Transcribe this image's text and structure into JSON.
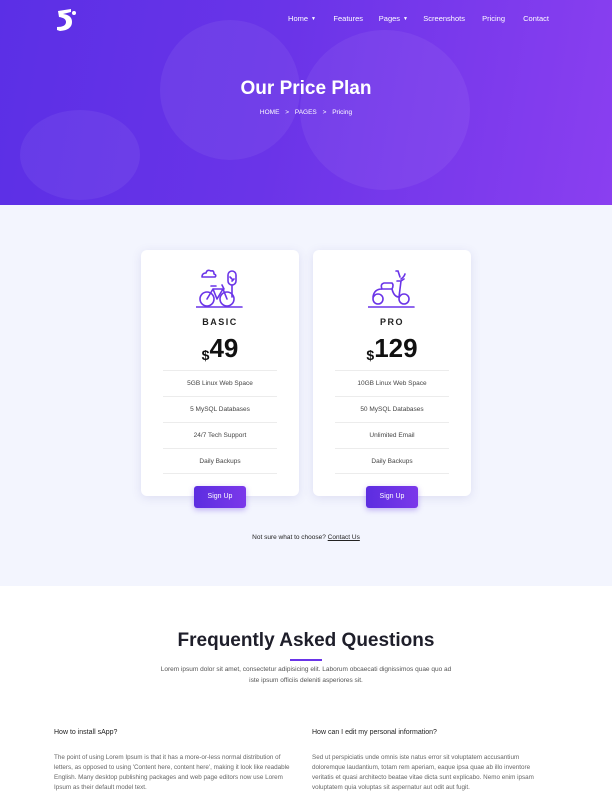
{
  "header": {
    "logo_icon": "s-logo-icon",
    "nav": [
      {
        "label": "Home",
        "dropdown": true
      },
      {
        "label": "Features",
        "dropdown": false
      },
      {
        "label": "Pages",
        "dropdown": true
      },
      {
        "label": "Screenshots",
        "dropdown": false
      },
      {
        "label": "Pricing",
        "dropdown": false
      },
      {
        "label": "Contact",
        "dropdown": false
      }
    ]
  },
  "hero": {
    "title": "Our Price Plan",
    "breadcrumb": [
      "HOME",
      ">",
      "PAGES",
      ">",
      "Pricing"
    ]
  },
  "plans": [
    {
      "icon": "bicycle-icon",
      "name": "BASIC",
      "currency": "$",
      "price": "49",
      "features": [
        "5GB Linux Web Space",
        "5 MySQL Databases",
        "24/7 Tech Support",
        "Daily Backups"
      ],
      "button": "Sign Up"
    },
    {
      "icon": "scooter-icon",
      "name": "PRO",
      "currency": "$",
      "price": "129",
      "features": [
        "10GB Linux Web Space",
        "50 MySQL Databases",
        "Unlimited Email",
        "Daily Backups"
      ],
      "button": "Sign Up"
    }
  ],
  "choose": {
    "text": "Not sure what to choose? ",
    "link": "Contact Us"
  },
  "faq": {
    "title": "Frequently Asked Questions",
    "subtitle": "Lorem ipsum dolor sit amet, consectetur adipisicing elit. Laborum obcaecati dignissimos quae quo ad iste ipsum officiis deleniti asperiores sit.",
    "items": [
      {
        "question": "How to install sApp?",
        "answer": "The point of using Lorem Ipsum is that it has a more-or-less normal distribution of letters, as opposed to using 'Content here, content here', making it look like readable English. Many desktop publishing packages and web page editors now use Lorem Ipsum as their default model text."
      },
      {
        "question": "How can I edit my personal information?",
        "answer": "Sed ut perspiciatis unde omnis iste natus error sit voluptatem accusantium doloremque laudantium, totam rem aperiam, eaque ipsa quae ab illo inventore veritatis et quasi architecto beatae vitae dicta sunt explicabo. Nemo enim ipsam voluptatem quia voluptas sit aspernatur aut odit aut fugit."
      }
    ]
  },
  "colors": {
    "accent": "#6a34e8",
    "hero_start": "#5b2fe6",
    "hero_end": "#8a3ff0",
    "pricing_bg": "#f3f5fe"
  }
}
